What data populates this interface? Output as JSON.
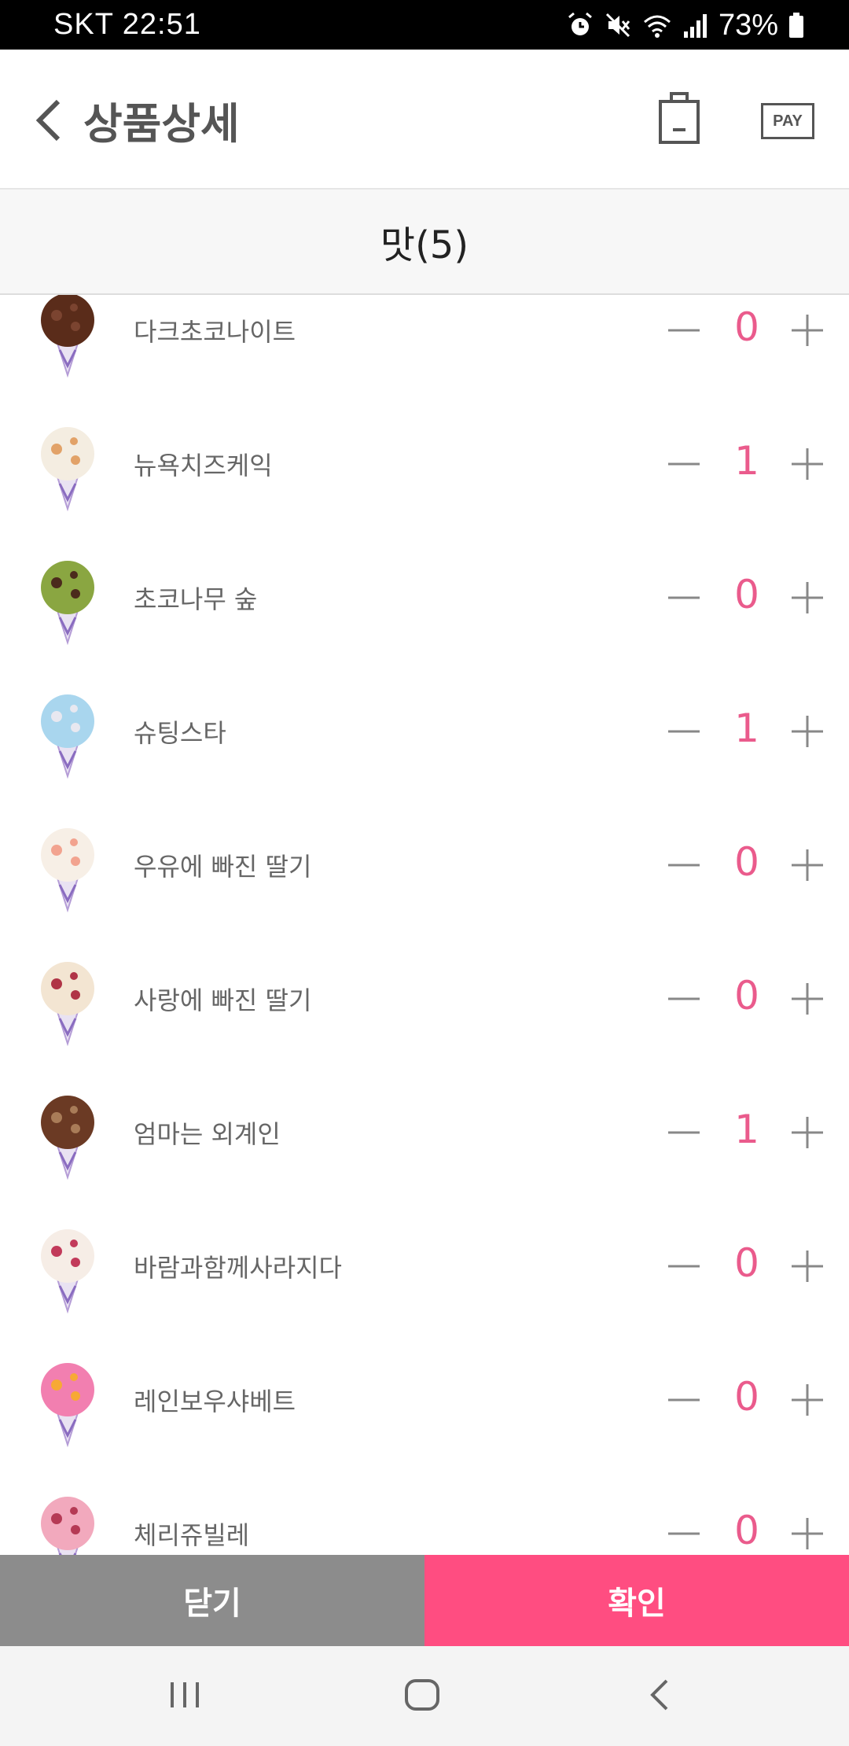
{
  "status_bar": {
    "carrier_time": "SKT 22:51",
    "battery": "73%"
  },
  "header": {
    "title": "상품상세",
    "pay_label": "PAY"
  },
  "section": {
    "label": "맛(5)"
  },
  "flavors": [
    {
      "name": "다크초코나이트",
      "qty": "0",
      "colors": [
        "#5a2c1a",
        "#7b4430"
      ]
    },
    {
      "name": "뉴욕치즈케익",
      "qty": "1",
      "colors": [
        "#f4ede1",
        "#e2a268"
      ]
    },
    {
      "name": "초코나무 숲",
      "qty": "0",
      "colors": [
        "#8aa641",
        "#4b2a1c"
      ]
    },
    {
      "name": "슈팅스타",
      "qty": "1",
      "colors": [
        "#a9d6ee",
        "#e8e8f0"
      ]
    },
    {
      "name": "우유에 빠진 딸기",
      "qty": "0",
      "colors": [
        "#f7efe6",
        "#f2a38f"
      ]
    },
    {
      "name": "사랑에 빠진 딸기",
      "qty": "0",
      "colors": [
        "#f3e5d2",
        "#b03446"
      ]
    },
    {
      "name": "엄마는 외계인",
      "qty": "1",
      "colors": [
        "#6b3a24",
        "#a97c58"
      ]
    },
    {
      "name": "바람과함께사라지다",
      "qty": "0",
      "colors": [
        "#f6ede6",
        "#c23a5a"
      ]
    },
    {
      "name": "레인보우샤베트",
      "qty": "0",
      "colors": [
        "#f27fb0",
        "#f7a935"
      ]
    },
    {
      "name": "체리쥬빌레",
      "qty": "0",
      "colors": [
        "#f2a9bd",
        "#b53a55"
      ]
    }
  ],
  "buttons": {
    "close": "닫기",
    "confirm": "확인"
  },
  "accent": "#ea5b8c"
}
